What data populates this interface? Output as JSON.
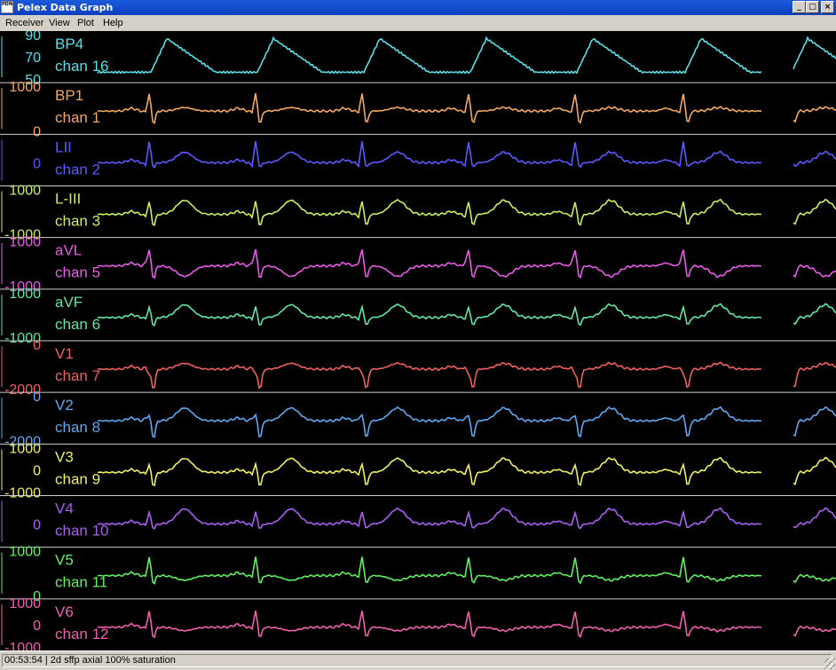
{
  "window": {
    "title": "Pelex Data Graph",
    "icon_text": "PDN",
    "controls": {
      "minimize": "_",
      "restore": "□",
      "close": "×"
    }
  },
  "menu": [
    "Receiver",
    "View",
    "Plot",
    "Help"
  ],
  "status": {
    "text": "00:53:54 | 2d sffp axial 100% saturation"
  },
  "channels": [
    {
      "lead": "BP4",
      "chan": "chan 16",
      "color": "#55e0e8",
      "ticks": [
        "90",
        "70",
        "50"
      ],
      "type": "bp"
    },
    {
      "lead": "BP1",
      "chan": "chan 1",
      "color": "#f4a860",
      "ticks": [
        "1000",
        "0"
      ],
      "type": "ecg"
    },
    {
      "lead": "LII",
      "chan": "chan 2",
      "color": "#5a5aff",
      "ticks": [
        "0"
      ],
      "type": "ecg"
    },
    {
      "lead": "L-III",
      "chan": "chan 3",
      "color": "#c8f060",
      "ticks": [
        "1000",
        "-1000"
      ],
      "type": "ecg"
    },
    {
      "lead": "aVL",
      "chan": "chan 5",
      "color": "#e85ae8",
      "ticks": [
        "1000",
        "-1000"
      ],
      "type": "ecg"
    },
    {
      "lead": "aVF",
      "chan": "chan 6",
      "color": "#60e8a0",
      "ticks": [
        "1000",
        "-1000"
      ],
      "type": "ecg"
    },
    {
      "lead": "V1",
      "chan": "chan 7",
      "color": "#f06060",
      "ticks": [
        "0",
        "-2000"
      ],
      "type": "ecg"
    },
    {
      "lead": "V2",
      "chan": "chan 8",
      "color": "#60a8f0",
      "ticks": [
        "0",
        "-2000"
      ],
      "type": "ecg"
    },
    {
      "lead": "V3",
      "chan": "chan 9",
      "color": "#f0f060",
      "ticks": [
        "1000",
        "0",
        "-1000"
      ],
      "type": "ecg"
    },
    {
      "lead": "V4",
      "chan": "chan 10",
      "color": "#a860f0",
      "ticks": [
        "0"
      ],
      "type": "ecg"
    },
    {
      "lead": "V5",
      "chan": "chan 11",
      "color": "#60f060",
      "ticks": [
        "1000",
        "0"
      ],
      "type": "ecg"
    },
    {
      "lead": "V6",
      "chan": "chan 12",
      "color": "#f060b0",
      "ticks": [
        "1000",
        "0",
        "-1000"
      ],
      "type": "ecg"
    }
  ]
}
